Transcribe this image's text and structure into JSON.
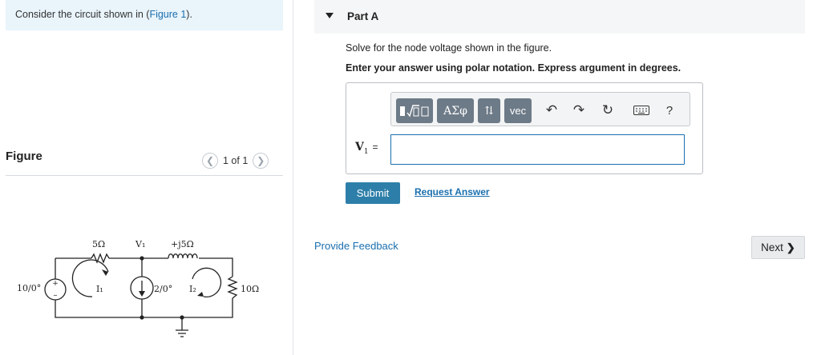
{
  "intro": {
    "prefix": "Consider the circuit shown in (",
    "link": "Figure 1",
    "suffix": ")."
  },
  "figure": {
    "label": "Figure",
    "pager": "1 of 1",
    "circuit": {
      "r1": "5Ω",
      "node": "V₁",
      "inductor": "+j5Ω",
      "source_v": "10/0°",
      "mesh1": "I₁",
      "source_i": "2/0°",
      "mesh2": "I₂",
      "r2": "10Ω"
    }
  },
  "part": {
    "title": "Part A"
  },
  "question": {
    "text": "Solve for the node voltage shown in the figure.",
    "instruction": "Enter your answer using polar notation. Express argument in degrees."
  },
  "toolbar": {
    "greek": "ΑΣφ",
    "arrows": "⇅",
    "vec": "vec",
    "help": "?"
  },
  "answer": {
    "var": "V",
    "sub": "1",
    "eq": "=",
    "value": ""
  },
  "actions": {
    "submit": "Submit",
    "request": "Request Answer",
    "feedback": "Provide Feedback",
    "next": "Next"
  },
  "colors": {
    "link": "#1a6fae",
    "submit_bg": "#2d7fa9",
    "intro_bg": "#e9f4fb",
    "toolbar_btn": "#6d7a87"
  }
}
